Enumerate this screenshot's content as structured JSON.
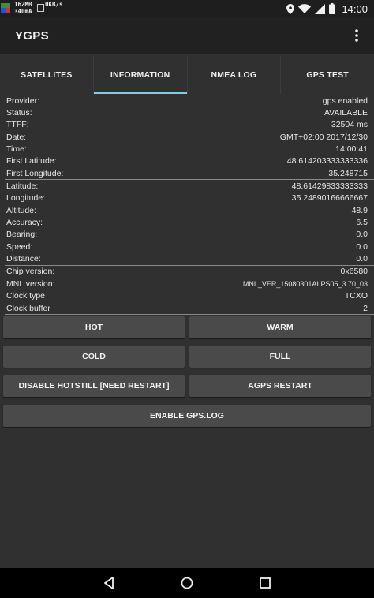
{
  "status_bar": {
    "mem_line1": "162MB",
    "mem_line2": "340mA",
    "net_speed": "0KB/s",
    "time": "14:00",
    "icons": [
      "location-icon",
      "wifi-icon",
      "signal-icon",
      "battery-icon"
    ]
  },
  "app": {
    "title": "YGPS",
    "overflow_icon": "more-vert-icon"
  },
  "tabs": [
    {
      "label": "SATELLITES",
      "active": false
    },
    {
      "label": "INFORMATION",
      "active": true
    },
    {
      "label": "NMEA LOG",
      "active": false
    },
    {
      "label": "GPS TEST",
      "active": false
    }
  ],
  "info": {
    "group1": [
      {
        "label": "Provider:",
        "value": "gps enabled"
      },
      {
        "label": "Status:",
        "value": "AVAILABLE"
      },
      {
        "label": "TTFF:",
        "value": "32504 ms"
      },
      {
        "label": "Date:",
        "value": "GMT+02:00 2017/12/30"
      },
      {
        "label": "Time:",
        "value": "14:00:41"
      },
      {
        "label": "First Latitude:",
        "value": "48.614203333333336"
      },
      {
        "label": "First Longitude:",
        "value": "35.248715"
      }
    ],
    "group2": [
      {
        "label": "Latitude:",
        "value": "48.61429833333333"
      },
      {
        "label": "Longitude:",
        "value": "35.24890166666667"
      },
      {
        "label": "Altitude:",
        "value": "48.9"
      },
      {
        "label": "Accuracy:",
        "value": "6.5"
      },
      {
        "label": "Bearing:",
        "value": "0.0"
      },
      {
        "label": "Speed:",
        "value": "0.0"
      },
      {
        "label": "Distance:",
        "value": "0.0"
      }
    ],
    "group3": [
      {
        "label": "Chip version:",
        "value": "0x6580"
      },
      {
        "label": "MNL version:",
        "value": "MNL_VER_15080301ALPS05_3.70_03"
      },
      {
        "label": "Clock type",
        "value": "TCXO"
      },
      {
        "label": "Clock buffer",
        "value": "2"
      }
    ]
  },
  "buttons": {
    "hot": "HOT",
    "warm": "WARM",
    "cold": "COLD",
    "full": "FULL",
    "disable_hotstill": "DISABLE HOTSTILL [NEED RESTART]",
    "agps_restart": "AGPS RESTART",
    "enable_gpslog": "ENABLE GPS.LOG"
  },
  "nav_bar": {
    "icons": [
      "back-icon",
      "home-icon",
      "recents-icon"
    ]
  },
  "colors": {
    "accent": "#7fcfe0",
    "background": "#303030",
    "appbar": "#212121",
    "button": "#4a4a4a"
  }
}
